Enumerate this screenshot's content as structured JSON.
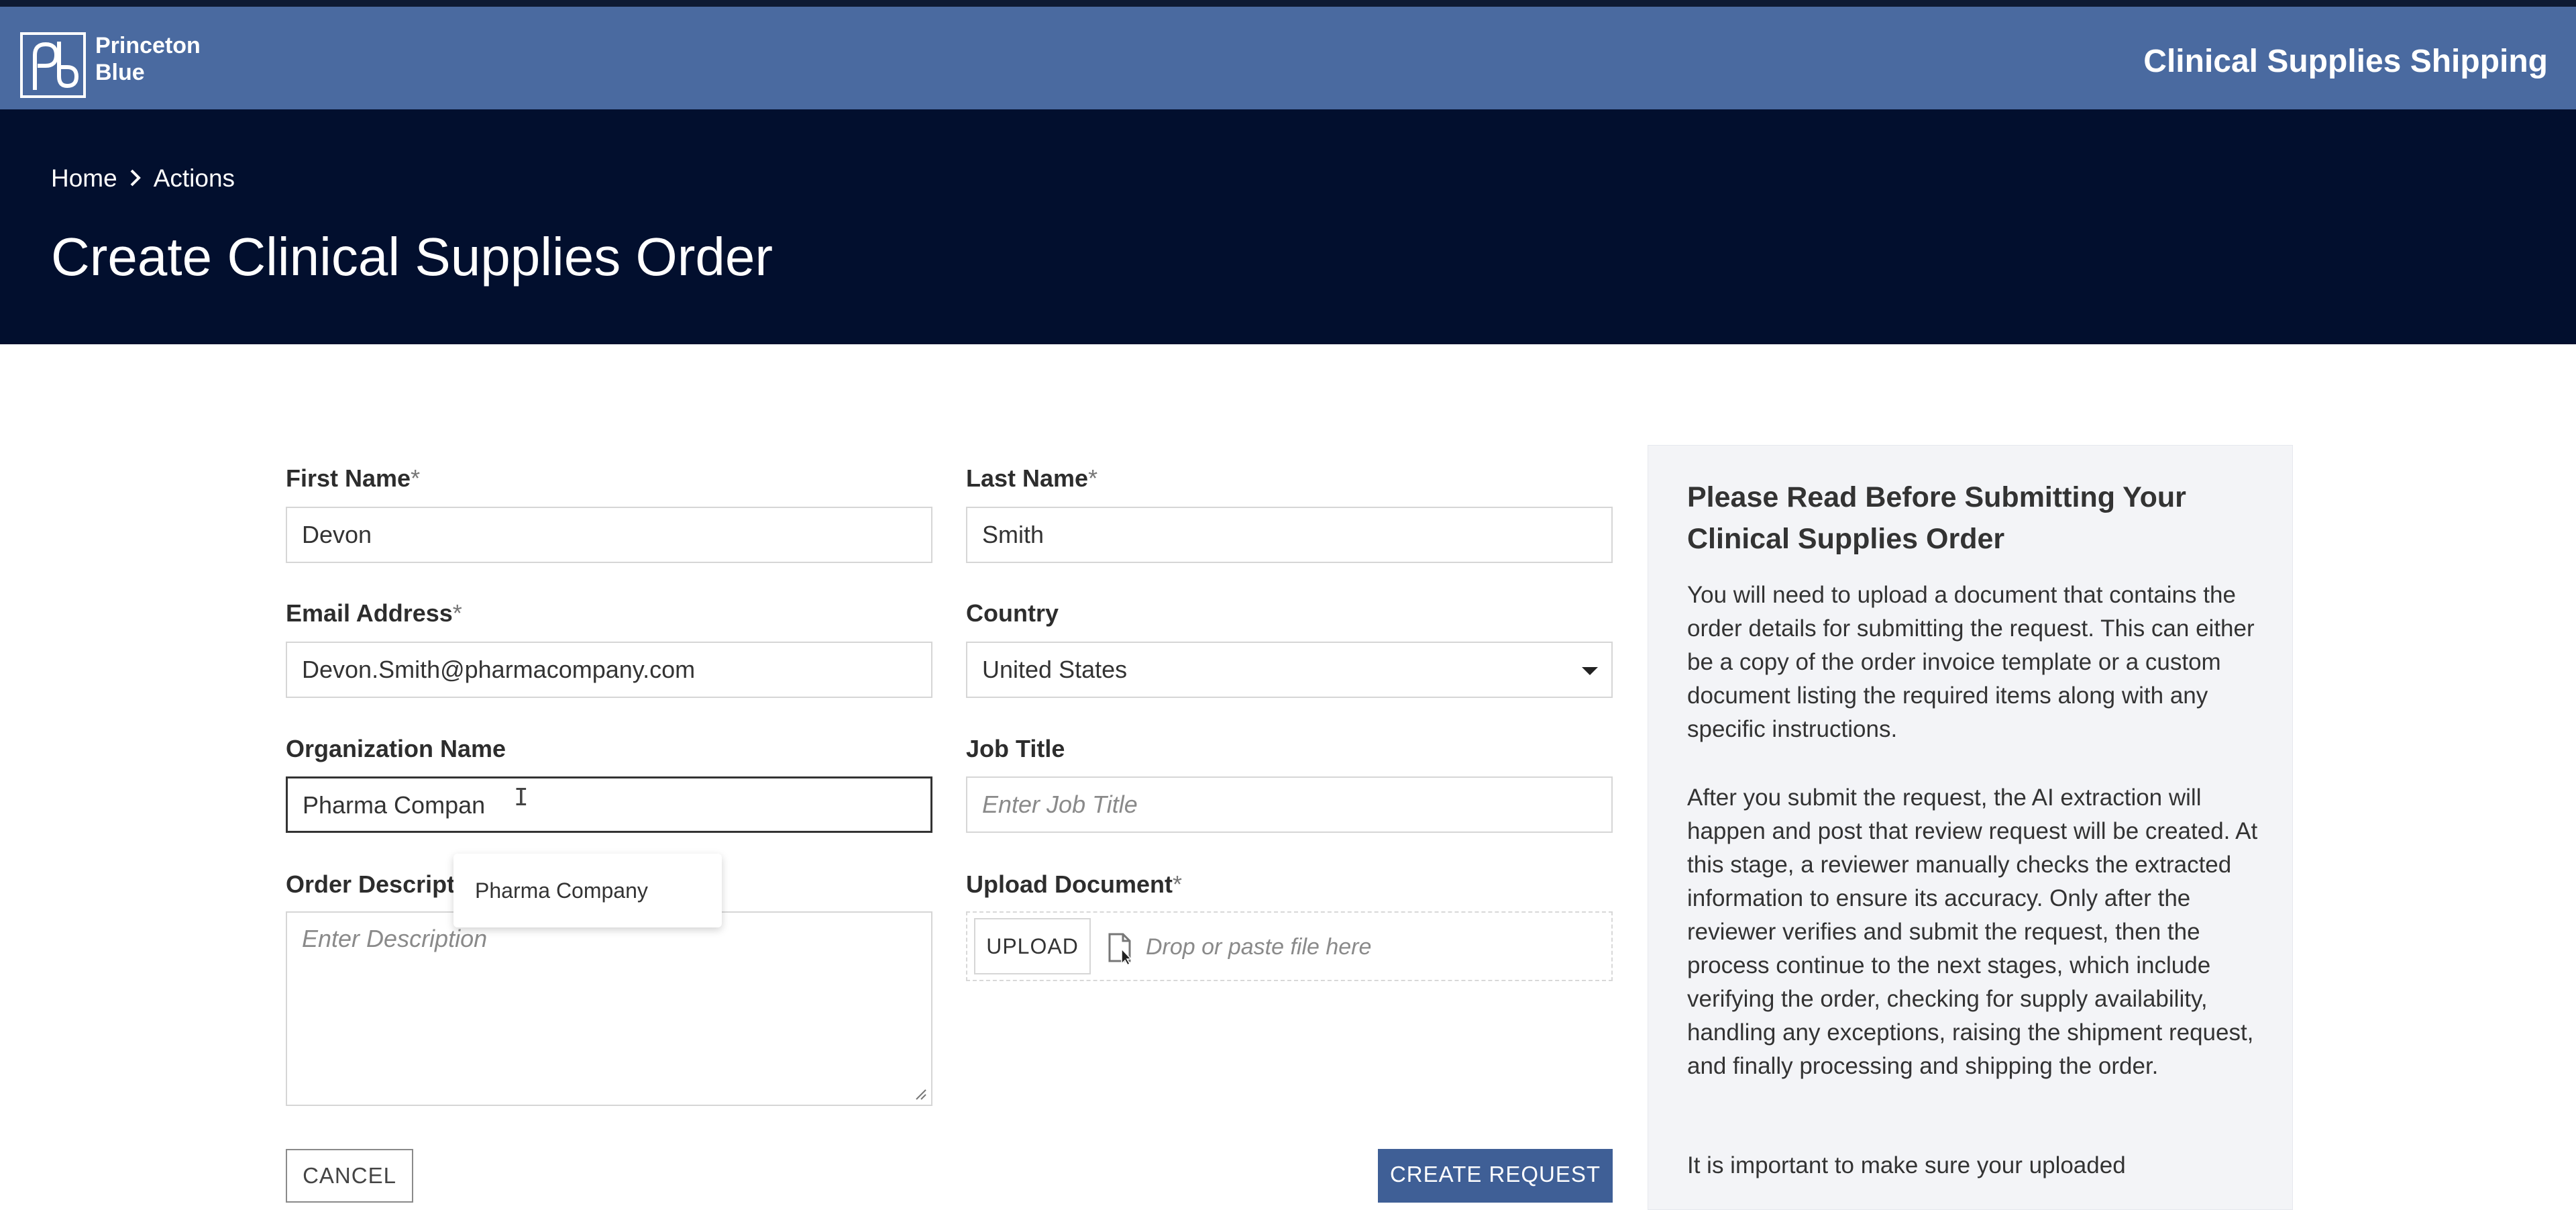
{
  "header": {
    "logo_line1": "Princeton",
    "logo_line2": "Blue",
    "app_name": "Clinical Supplies Shipping"
  },
  "breadcrumb": {
    "home": "Home",
    "separator": "›",
    "current": "Actions"
  },
  "page_title": "Create Clinical Supplies Order",
  "form": {
    "first_name": {
      "label": "First Name",
      "required_mark": "*",
      "value": "Devon"
    },
    "last_name": {
      "label": "Last Name",
      "required_mark": "*",
      "value": "Smith"
    },
    "email": {
      "label": "Email Address",
      "required_mark": "*",
      "value": "Devon.Smith@pharmacompany.com"
    },
    "country": {
      "label": "Country",
      "value": "United States"
    },
    "organization": {
      "label": "Organization Name",
      "value": "Pharma Compan",
      "suggestion": "Pharma Company"
    },
    "job_title": {
      "label": "Job Title",
      "placeholder": "Enter Job Title"
    },
    "order_description": {
      "label": "Order Descript",
      "placeholder": "Enter Description"
    },
    "upload": {
      "label": "Upload Document",
      "required_mark": "*",
      "button": "UPLOAD",
      "drop_text": "Drop or paste file here"
    }
  },
  "actions": {
    "cancel": "CANCEL",
    "create": "CREATE REQUEST"
  },
  "info_panel": {
    "title": "Please Read Before Submitting Your Clinical Supplies Order",
    "paragraph1": "You will need to upload a document that contains the order details for submitting the request. This can either be a copy of the order invoice template or a custom document listing the required items along with any specific instructions.",
    "paragraph2": "After you submit the request, the AI extraction will happen and post that review request will be created. At this stage, a reviewer manually checks the extracted information to ensure its accuracy. Only after the reviewer verifies and submit the request, then the process continue to the next stages, which include verifying the order, checking for supply availability, handling any exceptions, raising the shipment request, and finally processing and shipping the order.",
    "paragraph3": "It is important to make sure your uploaded"
  },
  "colors": {
    "header_bg": "#4a6aa0",
    "hero_bg": "#020f2e",
    "primary_button": "#3f5f96",
    "info_bg": "#f3f4f7"
  }
}
